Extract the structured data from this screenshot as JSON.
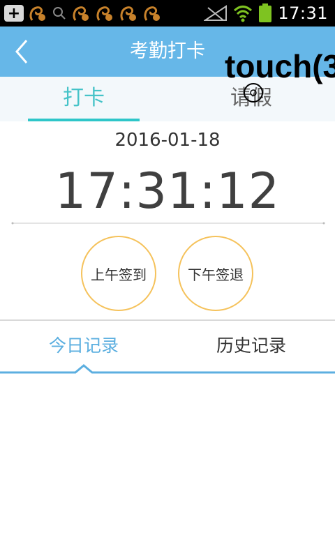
{
  "status_bar": {
    "time": "17:31",
    "icons": [
      "plus-box-icon",
      "squirrel-icon",
      "search-icon",
      "squirrel-icon",
      "squirrel-icon",
      "squirrel-icon",
      "squirrel-icon",
      "signal-muted-icon",
      "wifi-icon",
      "battery-icon"
    ]
  },
  "header": {
    "title": "考勤打卡",
    "back_icon": "chevron-left-icon"
  },
  "overlay": {
    "touch_text": "touch(3"
  },
  "tabs": [
    {
      "label": "打卡",
      "active": true
    },
    {
      "label": "请假",
      "active": false
    }
  ],
  "clock": {
    "date": "2016-01-18",
    "time": "17:31:12"
  },
  "punch": {
    "am_label": "上午签到",
    "pm_label": "下午签退"
  },
  "records": {
    "tabs": [
      {
        "label": "今日记录",
        "active": true
      },
      {
        "label": "历史记录",
        "active": false
      }
    ]
  },
  "colors": {
    "header_bg": "#66b7e8",
    "tab_active": "#45c3c8",
    "record_active": "#5cafe0",
    "punch_border": "#f5c25b"
  }
}
